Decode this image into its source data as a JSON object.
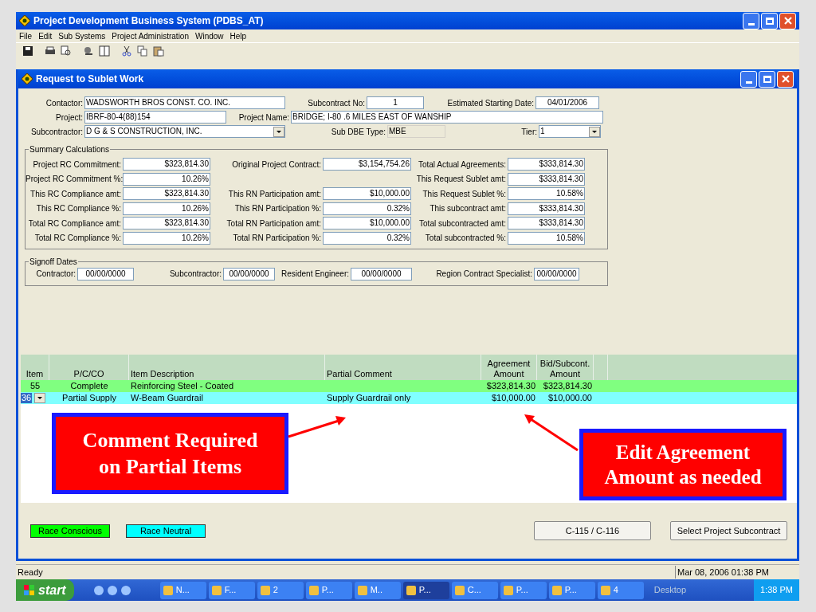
{
  "app": {
    "title": "Project Development Business System (PDBS_AT)"
  },
  "menu": [
    "File",
    "Edit",
    "Sub Systems",
    "Project Administration",
    "Window",
    "Help"
  ],
  "child_window": {
    "title": "Request to Sublet Work"
  },
  "header_rows": [
    [
      {
        "label": "Contactor:",
        "value": "WADSWORTH BROS CONST. CO. INC.",
        "kind": "text"
      },
      {
        "label": "Subcontract No:",
        "value": "1",
        "kind": "text"
      },
      {
        "label": "Estimated Starting Date:",
        "value": "04/01/2006",
        "kind": "text"
      }
    ],
    [
      {
        "label": "Project:",
        "value": "IBRF-80-4(88)154",
        "kind": "text"
      },
      {
        "label": "Project Name:",
        "value": "BRIDGE; I-80 .6 MILES EAST OF WANSHIP",
        "kind": "text"
      }
    ],
    [
      {
        "label": "Subcontractor:",
        "value": "D G & S CONSTRUCTION, INC.",
        "kind": "dropdown"
      },
      {
        "label": "Sub DBE Type:",
        "value": "MBE",
        "kind": "readonly"
      },
      {
        "label": "Tier:",
        "value": "1",
        "kind": "dropdown"
      }
    ]
  ],
  "summary": {
    "title": "Summary Calculations",
    "columns": [
      [
        {
          "label": "Project RC Commitment:",
          "value": "$323,814.30"
        },
        {
          "label": "Project RC Commitment %:",
          "value": "10.26%"
        },
        {
          "label": "This RC Compliance amt:",
          "value": "$323,814.30"
        },
        {
          "label": "This RC Compliance %:",
          "value": "10.26%"
        },
        {
          "label": "Total RC Compliance amt:",
          "value": "$323,814.30"
        },
        {
          "label": "Total RC Compliance %:",
          "value": "10.26%"
        }
      ],
      [
        {
          "label": "Original Project Contract:",
          "value": "$3,154,754.26"
        },
        {
          "kind": "empty"
        },
        {
          "label": "This RN Participation amt:",
          "value": "$10,000.00"
        },
        {
          "label": "This RN Participation %:",
          "value": "0.32%"
        },
        {
          "label": "Total RN Participation amt:",
          "value": "$10,000.00"
        },
        {
          "label": "Total RN Participation %:",
          "value": "0.32%"
        }
      ],
      [
        {
          "label": "Total Actual Agreements:",
          "value": "$333,814.30"
        },
        {
          "label": "This Request Sublet amt:",
          "value": "$333,814.30"
        },
        {
          "label": "This Request Sublet %:",
          "value": "10.58%"
        },
        {
          "label": "This subcontract amt:",
          "value": "$333,814.30"
        },
        {
          "label": "Total subcontracted amt:",
          "value": "$333,814.30"
        },
        {
          "label": "Total subcontracted %:",
          "value": "10.58%"
        }
      ]
    ]
  },
  "signoff": {
    "title": "Signoff Dates",
    "fields": [
      {
        "label": "Contractor:",
        "value": "00/00/0000"
      },
      {
        "label": "Subcontractor:",
        "value": "00/00/0000"
      },
      {
        "label": "Resident Engineer:",
        "value": "00/00/0000"
      },
      {
        "label": "Region Contract Specialist:",
        "value": "00/00/0000"
      }
    ]
  },
  "table": {
    "columns": [
      "Item",
      "P/C/CO",
      "Item Description",
      "Partial Comment",
      "Agreement Amount",
      "Bid/Subcont. Amount"
    ],
    "rows": [
      {
        "cells": [
          "55",
          "Complete",
          "Reinforcing Steel - Coated",
          "",
          "$323,814.30",
          "$323,814.30"
        ],
        "color": "#80ff80",
        "selected": false
      },
      {
        "cells": [
          "36",
          "Partial Supply",
          "W-Beam Guardrail",
          "Supply Guardrail only",
          "$10,000.00",
          "$10,000.00"
        ],
        "color": "#80ffff",
        "selected": true
      }
    ]
  },
  "legend": [
    {
      "label": "Race Conscious",
      "color": "#00ff00"
    },
    {
      "label": "Race Neutral",
      "color": "#00ffff"
    }
  ],
  "buttons": [
    "C-115 / C-116",
    "Select Project Subcontract"
  ],
  "status_bar": {
    "text": "Ready",
    "datetime": "Mar 08, 2006 01:38 PM"
  },
  "taskbar": {
    "start": "start",
    "buttons": [
      {
        "label": "N...",
        "selected": false
      },
      {
        "label": "F...",
        "selected": false
      },
      {
        "label": "2",
        "selected": false
      },
      {
        "label": "P...",
        "selected": false
      },
      {
        "label": "M..",
        "selected": false
      },
      {
        "label": "P...",
        "selected": true
      },
      {
        "label": "C...",
        "selected": false
      },
      {
        "label": "P...",
        "selected": false
      },
      {
        "label": "P...",
        "selected": false
      },
      {
        "label": "4",
        "selected": false
      }
    ],
    "desktop": "Desktop",
    "clock": "1:38 PM"
  },
  "callouts": [
    "Comment Required on Partial Items",
    "Edit Agreement Amount as needed"
  ]
}
